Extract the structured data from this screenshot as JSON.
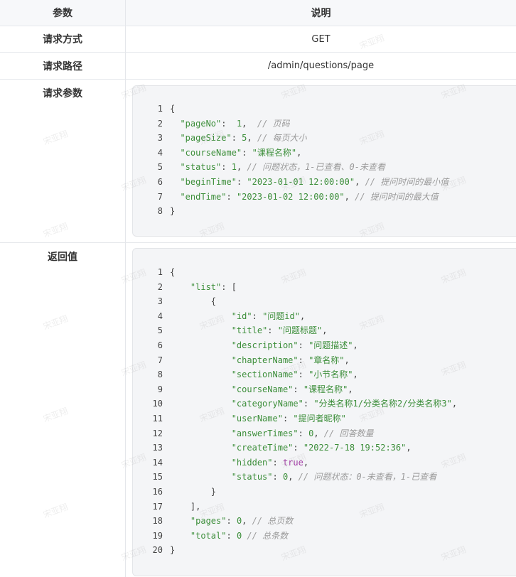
{
  "table": {
    "header": {
      "param": "参数",
      "desc": "说明"
    },
    "rows": {
      "method": {
        "label": "请求方式",
        "value": "GET"
      },
      "path": {
        "label": "请求路径",
        "value": "/admin/questions/page"
      },
      "params": {
        "label": "请求参数"
      },
      "returns": {
        "label": "返回值"
      }
    }
  },
  "request_code": [
    [
      [
        "p",
        "{"
      ]
    ],
    [
      [
        "p",
        "  "
      ],
      [
        "s",
        "\"pageNo\""
      ],
      [
        "p",
        ":  "
      ],
      [
        "n",
        "1"
      ],
      [
        "p",
        ",  "
      ],
      [
        "c",
        "// 页码"
      ]
    ],
    [
      [
        "p",
        "  "
      ],
      [
        "s",
        "\"pageSize\""
      ],
      [
        "p",
        ": "
      ],
      [
        "n",
        "5"
      ],
      [
        "p",
        ", "
      ],
      [
        "c",
        "// 每页大小"
      ]
    ],
    [
      [
        "p",
        "  "
      ],
      [
        "s",
        "\"courseName\""
      ],
      [
        "p",
        ": "
      ],
      [
        "s",
        "\"课程名称\""
      ],
      [
        "p",
        ","
      ]
    ],
    [
      [
        "p",
        "  "
      ],
      [
        "s",
        "\"status\""
      ],
      [
        "p",
        ": "
      ],
      [
        "n",
        "1"
      ],
      [
        "p",
        ", "
      ],
      [
        "c",
        "// 问题状态，1-已查看、0-未查看"
      ]
    ],
    [
      [
        "p",
        "  "
      ],
      [
        "s",
        "\"beginTime\""
      ],
      [
        "p",
        ": "
      ],
      [
        "s",
        "\"2023-01-01 12:00:00\""
      ],
      [
        "p",
        ", "
      ],
      [
        "c",
        "// 提问时间的最小值"
      ]
    ],
    [
      [
        "p",
        "  "
      ],
      [
        "s",
        "\"endTime\""
      ],
      [
        "p",
        ": "
      ],
      [
        "s",
        "\"2023-01-02 12:00:00\""
      ],
      [
        "p",
        ", "
      ],
      [
        "c",
        "// 提问时间的最大值"
      ]
    ],
    [
      [
        "p",
        "}"
      ]
    ]
  ],
  "response_code": [
    [
      [
        "p",
        "{"
      ]
    ],
    [
      [
        "p",
        "    "
      ],
      [
        "s",
        "\"list\""
      ],
      [
        "p",
        ": ["
      ]
    ],
    [
      [
        "p",
        "        {"
      ]
    ],
    [
      [
        "p",
        "            "
      ],
      [
        "s",
        "\"id\""
      ],
      [
        "p",
        ": "
      ],
      [
        "s",
        "\"问题id\""
      ],
      [
        "p",
        ","
      ]
    ],
    [
      [
        "p",
        "            "
      ],
      [
        "s",
        "\"title\""
      ],
      [
        "p",
        ": "
      ],
      [
        "s",
        "\"问题标题\""
      ],
      [
        "p",
        ","
      ]
    ],
    [
      [
        "p",
        "            "
      ],
      [
        "s",
        "\"description\""
      ],
      [
        "p",
        ": "
      ],
      [
        "s",
        "\"问题描述\""
      ],
      [
        "p",
        ","
      ]
    ],
    [
      [
        "p",
        "            "
      ],
      [
        "s",
        "\"chapterName\""
      ],
      [
        "p",
        ": "
      ],
      [
        "s",
        "\"章名称\""
      ],
      [
        "p",
        ","
      ]
    ],
    [
      [
        "p",
        "            "
      ],
      [
        "s",
        "\"sectionName\""
      ],
      [
        "p",
        ": "
      ],
      [
        "s",
        "\"小节名称\""
      ],
      [
        "p",
        ","
      ]
    ],
    [
      [
        "p",
        "            "
      ],
      [
        "s",
        "\"courseName\""
      ],
      [
        "p",
        ": "
      ],
      [
        "s",
        "\"课程名称\""
      ],
      [
        "p",
        ","
      ]
    ],
    [
      [
        "p",
        "            "
      ],
      [
        "s",
        "\"categoryName\""
      ],
      [
        "p",
        ": "
      ],
      [
        "s",
        "\"分类名称1/分类名称2/分类名称3\""
      ],
      [
        "p",
        ","
      ]
    ],
    [
      [
        "p",
        "            "
      ],
      [
        "s",
        "\"userName\""
      ],
      [
        "p",
        ": "
      ],
      [
        "s",
        "\"提问者昵称\""
      ]
    ],
    [
      [
        "p",
        "            "
      ],
      [
        "s",
        "\"answerTimes\""
      ],
      [
        "p",
        ": "
      ],
      [
        "n",
        "0"
      ],
      [
        "p",
        ", "
      ],
      [
        "c",
        "// 回答数量"
      ]
    ],
    [
      [
        "p",
        "            "
      ],
      [
        "s",
        "\"createTime\""
      ],
      [
        "p",
        ": "
      ],
      [
        "s",
        "\"2022-7-18 19:52:36\""
      ],
      [
        "p",
        ","
      ]
    ],
    [
      [
        "p",
        "            "
      ],
      [
        "s",
        "\"hidden\""
      ],
      [
        "p",
        ": "
      ],
      [
        "b",
        "true"
      ],
      [
        "p",
        ","
      ]
    ],
    [
      [
        "p",
        "            "
      ],
      [
        "s",
        "\"status\""
      ],
      [
        "p",
        ": "
      ],
      [
        "n",
        "0"
      ],
      [
        "p",
        ", "
      ],
      [
        "c",
        "// 问题状态：0-未查看，1-已查看"
      ]
    ],
    [
      [
        "p",
        "        }"
      ]
    ],
    [
      [
        "p",
        "    ],"
      ]
    ],
    [
      [
        "p",
        "    "
      ],
      [
        "s",
        "\"pages\""
      ],
      [
        "p",
        ": "
      ],
      [
        "n",
        "0"
      ],
      [
        "p",
        ", "
      ],
      [
        "c",
        "// 总页数"
      ]
    ],
    [
      [
        "p",
        "    "
      ],
      [
        "s",
        "\"total\""
      ],
      [
        "p",
        ": "
      ],
      [
        "n",
        "0"
      ],
      [
        "p",
        " "
      ],
      [
        "c",
        "// 总条数"
      ]
    ],
    [
      [
        "p",
        "}"
      ]
    ]
  ],
  "watermark": "宋亚翔"
}
